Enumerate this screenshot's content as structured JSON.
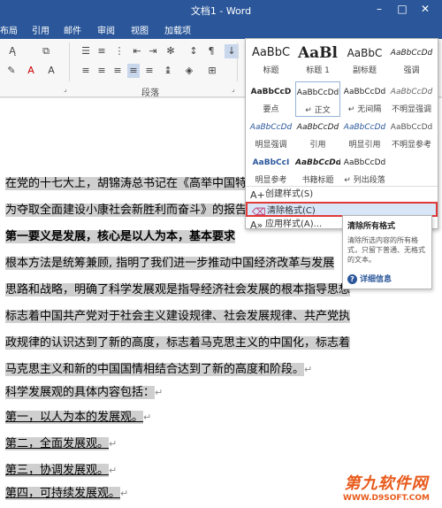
{
  "window": {
    "title": "文档1 - Word"
  },
  "ribbon": {
    "tabs": [
      "布局",
      "引用",
      "邮件",
      "审阅",
      "视图",
      "加载项"
    ],
    "paragraph_group_label": "段落"
  },
  "styles_gallery": {
    "rows": [
      [
        {
          "sample": "AaBbC",
          "name": "标题"
        },
        {
          "sample": "AaBl",
          "name": "标题 1"
        },
        {
          "sample": "AaBbC",
          "name": "副标题"
        },
        {
          "sample": "AaBbCcDd",
          "name": "强调"
        }
      ],
      [
        {
          "sample": "AaBbCcD",
          "name": "要点"
        },
        {
          "sample": "AaBbCcDd",
          "name": "↵ 正文"
        },
        {
          "sample": "AaBbCcDd",
          "name": "↵ 无间隔"
        },
        {
          "sample": "AaBbCcDd",
          "name": "不明显强调"
        }
      ],
      [
        {
          "sample": "AaBbCcDd",
          "name": "明显强调"
        },
        {
          "sample": "AaBbCcDd",
          "name": "引用"
        },
        {
          "sample": "AaBbCcDd",
          "name": "明显引用"
        },
        {
          "sample": "AaBbCcDd",
          "name": "不明显参考"
        }
      ],
      [
        {
          "sample": "AaBbCcI",
          "name": "明显参考"
        },
        {
          "sample": "AaBbCcDd",
          "name": "书籍标题"
        },
        {
          "sample": "AaBbCcDd",
          "name": "↵ 列出段落"
        },
        {
          "sample": "",
          "name": ""
        }
      ]
    ],
    "menu": [
      {
        "label": "创建样式(S)"
      },
      {
        "label": "清除格式(C)"
      },
      {
        "label": "应用样式(A)..."
      }
    ]
  },
  "tooltip": {
    "title": "清除所有格式",
    "body": "清除所选内容的所有格式，只留下普通、无格式的文本。",
    "link": "详细信息"
  },
  "document": {
    "lines": [
      "在党的十七大上，胡锦涛总书记在《高举中国特",
      "为夺取全面建设小康社会新胜利而奋斗》的报告",
      "第一要义是发展，核心是以人为本，基本要求",
      "根本方法是统筹兼顾, 指明了我们进一步推动中国经济改革与发展",
      "思路和战略，明确了科学发展观是指导经济社会发展的根本指导思想",
      "标志着中国共产党对于社会主义建设规律、社会发展规律、共产党执",
      "政规律的认识达到了新的高度，标志着马克思主义的中国化，标志着",
      "马克思主义和新的中国国情相结合达到了新的高度和阶段。",
      "科学发展观的具体内容包括：",
      "第一，以人为本的发展观。",
      "第二，全面发展观。",
      "第三，协调发展观。",
      "第四，可持续发展观。"
    ]
  },
  "watermark": {
    "main": "第九软件网",
    "sub": "WWW.D9SOFT.COM"
  },
  "colors": {
    "accent": "#2b579a",
    "highlight": "#cfcfcf",
    "menu_hot_border": "#e03a3a"
  }
}
